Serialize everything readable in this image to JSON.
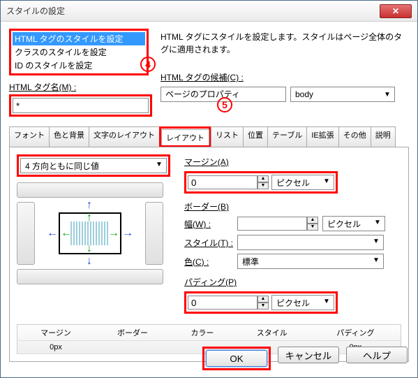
{
  "window": {
    "title": "スタイルの設定"
  },
  "stylelist": {
    "items": [
      "HTML タグのスタイルを設定",
      "クラスのスタイルを設定",
      "ID のスタイルを設定"
    ],
    "selected": 0
  },
  "description": "HTML タグにスタイルを設定します。スタイルはページ全体のタグに適用されます。",
  "labels": {
    "tagname": "HTML タグ名(M) :",
    "candidates": "HTML タグの候補(C) :",
    "margin": "マージン(A)",
    "border": "ボーダー(B)",
    "width": "幅(W) :",
    "style": "スタイル(T) :",
    "color": "色(C) :",
    "padding": "パディング(P)"
  },
  "tagname_value": "*",
  "candidate": {
    "text": "ページのプロパティ",
    "tag": "body"
  },
  "tabs": [
    "フォント",
    "色と背景",
    "文字のレイアウト",
    "レイアウト",
    "リスト",
    "位置",
    "テーブル",
    "IE拡張",
    "その他",
    "説明"
  ],
  "active_tab": 3,
  "direction_combo": "4 方向ともに同じ値",
  "margin": {
    "value": "0",
    "unit": "ピクセル"
  },
  "border": {
    "width": "",
    "width_unit": "ピクセル",
    "style": "",
    "color": "標準"
  },
  "padding": {
    "value": "0",
    "unit": "ピクセル"
  },
  "table": {
    "headers": [
      "マージン",
      "ボーダー",
      "カラー",
      "スタイル",
      "パディング"
    ],
    "row": [
      "0px",
      "",
      "",
      "",
      "0px"
    ]
  },
  "buttons": {
    "ok": "OK",
    "cancel": "キャンセル",
    "help": "ヘルプ"
  },
  "annotations": {
    "a4": "4",
    "a5": "5"
  }
}
